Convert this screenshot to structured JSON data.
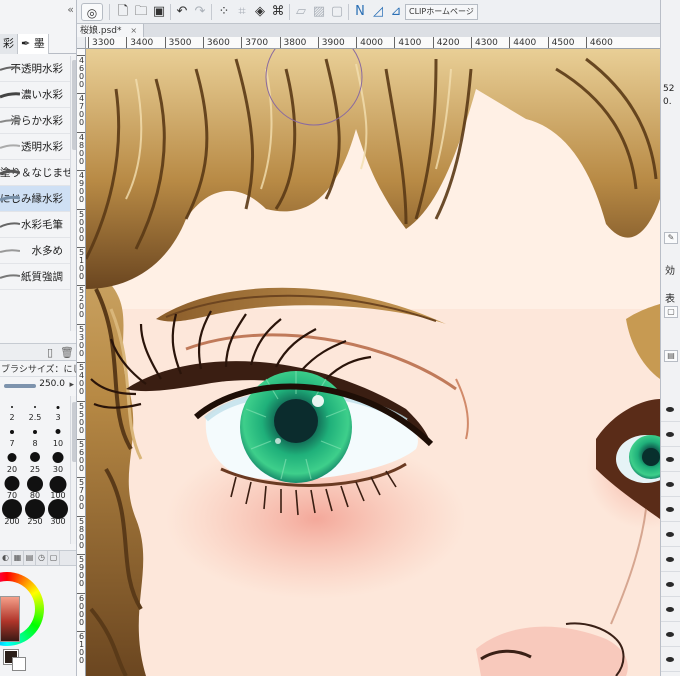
{
  "left_panel": {
    "tabs": [
      {
        "label": "彩",
        "icon": "brush-tab-icon",
        "active": false
      },
      {
        "label": "墨",
        "icon": "pen-icon",
        "active": true
      }
    ],
    "brushes": [
      {
        "label": "不透明水彩",
        "selected": false
      },
      {
        "label": "濃い水彩",
        "selected": false
      },
      {
        "label": "滑らか水彩",
        "selected": false
      },
      {
        "label": "透明水彩",
        "selected": false
      },
      {
        "label": "塗り＆なじませ",
        "selected": false
      },
      {
        "label": "にじみ縁水彩",
        "selected": true
      },
      {
        "label": "水彩毛筆",
        "selected": false
      },
      {
        "label": "水多め",
        "selected": false
      },
      {
        "label": "紙質強調",
        "selected": false
      }
    ],
    "brush_size": {
      "title": "ブラシサイズ：にじみ縁水彩",
      "value": "250.0",
      "sizes": [
        "2",
        "2.5",
        "3",
        "7",
        "8",
        "10",
        "20",
        "25",
        "30",
        "70",
        "80",
        "100",
        "200",
        "250",
        "300"
      ]
    },
    "color": {
      "foreground": "#2b1f19",
      "background": "#ffffff"
    }
  },
  "toolbar": {
    "buttons": [
      "app-icon",
      "new-icon",
      "open-icon",
      "save-icon",
      "undo-icon",
      "redo-icon",
      "clear-selection-icon",
      "crop-icon",
      "fill-icon",
      "transform-icon",
      "snap-ruler-icon",
      "snap-grid-icon",
      "snap-guide-icon",
      "pen-settings-icon",
      "brush-settings-icon",
      "eraser-settings-icon"
    ],
    "home_label": "CLIPホームページ"
  },
  "document": {
    "tab_name": "桜娘.psd*",
    "close_glyph": "×"
  },
  "rulers": {
    "horizontal": [
      "3300",
      "3400",
      "3500",
      "3600",
      "3700",
      "3800",
      "3900",
      "4000",
      "4100",
      "4200",
      "4300",
      "4400",
      "4500",
      "4600"
    ],
    "vertical": [
      "4600",
      "4700",
      "4800",
      "4900",
      "5000",
      "5100",
      "5200",
      "5300",
      "5400",
      "5500",
      "5600",
      "5700",
      "5800",
      "5900",
      "6000",
      "6100"
    ]
  },
  "right_panel": {
    "navigator_zoom": "52",
    "navigator_angle": "0.",
    "labels": [
      "効",
      "表"
    ]
  },
  "colors": {
    "accent": "#cfe0f4",
    "hair": "#a67a3c",
    "skin": "#fde4d6",
    "iris": "#22b07a"
  }
}
